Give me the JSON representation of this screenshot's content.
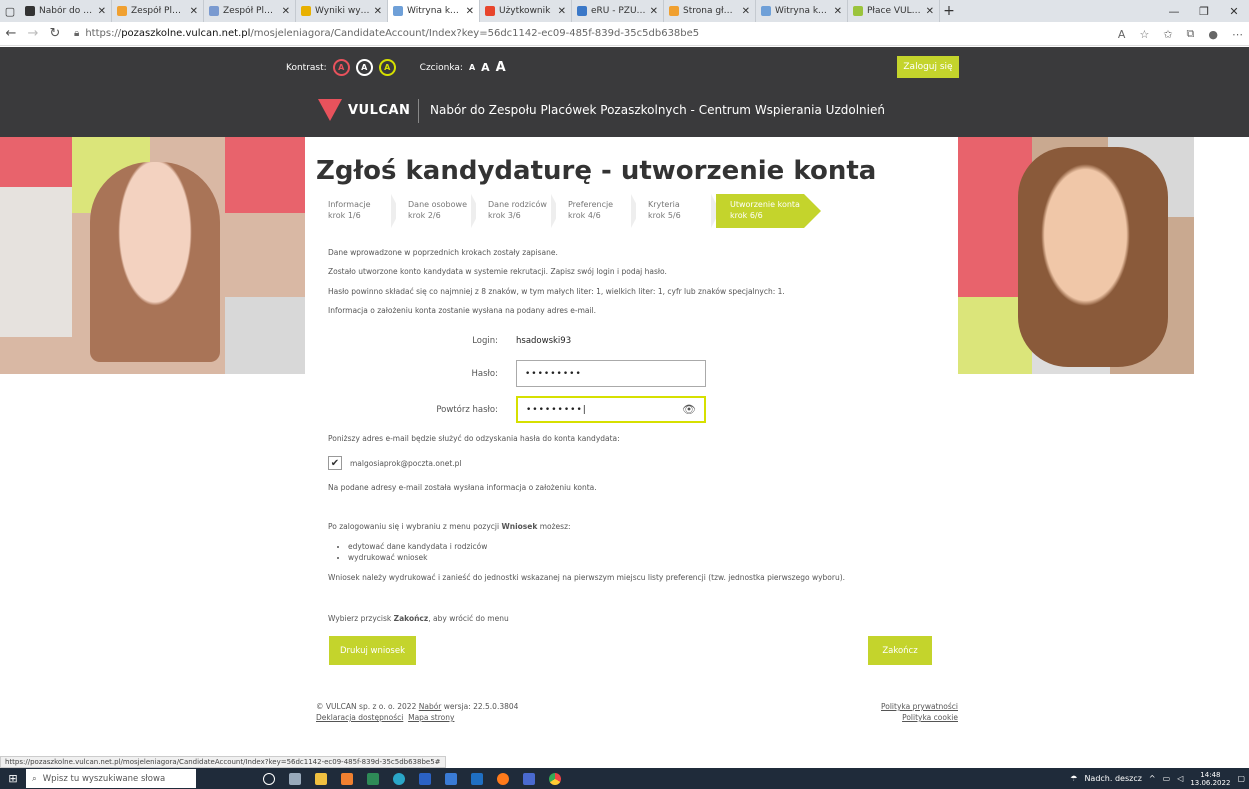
{
  "browser": {
    "tabs": [
      {
        "title": "Nabór do Zespołu",
        "color": "#333333"
      },
      {
        "title": "Zespół Placówek P",
        "color": "#f0a030"
      },
      {
        "title": "Zespół Placówek P",
        "color": "#7a9ad0"
      },
      {
        "title": "Wyniki wyszukiwar",
        "color": "#e8b000"
      },
      {
        "title": "Witryna kandydata",
        "color": "#6fa0d8",
        "active": true
      },
      {
        "title": "Użytkownik",
        "color": "#e8452c"
      },
      {
        "title": "eRU - PZU eru",
        "color": "#3b78c8"
      },
      {
        "title": "Strona główna | Je",
        "color": "#f0a030"
      },
      {
        "title": "Witryna kandydata",
        "color": "#6fa0d8"
      },
      {
        "title": "Płace VULCAN",
        "color": "#9bc43c"
      }
    ],
    "url_prefix": "https://",
    "url_host": "pozaszkolne.vulcan.net.pl",
    "url_path": "/mosjeleniagora/CandidateAccount/Index?key=56dc1142-ec09-485f-839d-35c5db638be5",
    "status_url": "https://pozaszkolne.vulcan.net.pl/mosjeleniagora/CandidateAccount/Index?key=56dc1142-ec09-485f-839d-35c5db638be5#"
  },
  "header": {
    "kontrast_label": "Kontrast:",
    "czcionka_label": "Czcionka:",
    "font_a_small": "A",
    "font_a_medium": "A",
    "font_a_large": "A",
    "contrast_glyph": "A",
    "login_button": "Zaloguj się",
    "logo_text": "VULCAN",
    "site_title": "Nabór do Zespołu Placówek Pozaszkolnych - Centrum Wspierania Uzdolnień"
  },
  "page": {
    "title": "Zgłoś kandydaturę - utworzenie konta",
    "steps": [
      {
        "name": "Informacje",
        "num": "krok 1/6"
      },
      {
        "name": "Dane osobowe",
        "num": "krok 2/6"
      },
      {
        "name": "Dane rodziców",
        "num": "krok 3/6"
      },
      {
        "name": "Preferencje",
        "num": "krok 4/6"
      },
      {
        "name": "Kryteria",
        "num": "krok 5/6"
      },
      {
        "name": "Utworzenie konta",
        "num": "krok 6/6"
      }
    ],
    "messages": [
      "Dane wprowadzone w poprzednich krokach zostały zapisane.",
      "Zostało utworzone konto kandydata w systemie rekrutacji. Zapisz swój login i podaj hasło.",
      "Hasło powinno składać się co najmniej z 8 znaków, w tym małych liter: 1, wielkich liter: 1, cyfr lub znaków specjalnych: 1.",
      "Informacja o założeniu konta zostanie wysłana na podany adres e-mail."
    ],
    "login_label": "Login:",
    "login_value": "hsadowski93",
    "password_label": "Hasło:",
    "password_value": "•••••••••",
    "repeat_label": "Powtórz hasło:",
    "repeat_value": "•••••••••|",
    "email_intro": "Poniższy adres e-mail będzie służyć do odzyskania hasła do konta kandydata:",
    "email_value": "malgosiaprok@poczta.onet.pl",
    "email_sent": "Na podane adresy e-mail została wysłana informacja o założeniu konta.",
    "after_login_prefix": "Po zalogowaniu się i wybraniu z menu pozycji ",
    "after_login_bold": "Wniosek",
    "after_login_suffix": " możesz:",
    "bullets": [
      "edytować dane kandydata i rodziców",
      "wydrukować wniosek"
    ],
    "print_note": "Wniosek należy wydrukować i zanieść do jednostki wskazanej na pierwszym miejscu listy preferencji (tzw. jednostka pierwszego wyboru).",
    "finish_prefix": "Wybierz przycisk ",
    "finish_bold": "Zakończ",
    "finish_suffix": ", aby wrócić do menu",
    "print_button": "Drukuj wniosek",
    "finish_button": "Zakończ"
  },
  "footer": {
    "copyright": "© VULCAN sp. z o. o. 2022 ",
    "nabor_link": "Nabór",
    "version": " wersja: 22.5.0.3804",
    "accessibility": "Deklaracja dostępności",
    "sitemap": "Mapa strony",
    "privacy": "Polityka prywatności",
    "cookie": "Polityka cookie"
  },
  "taskbar": {
    "search_placeholder": "Wpisz tu wyszukiwane słowa",
    "weather": "Nadch. deszcz",
    "time": "14:48",
    "date": "13.06.2022"
  },
  "colors": {
    "accent_green": "#c4d42c",
    "accent_red": "#e8525c",
    "header_dark": "#3a3a3c"
  }
}
